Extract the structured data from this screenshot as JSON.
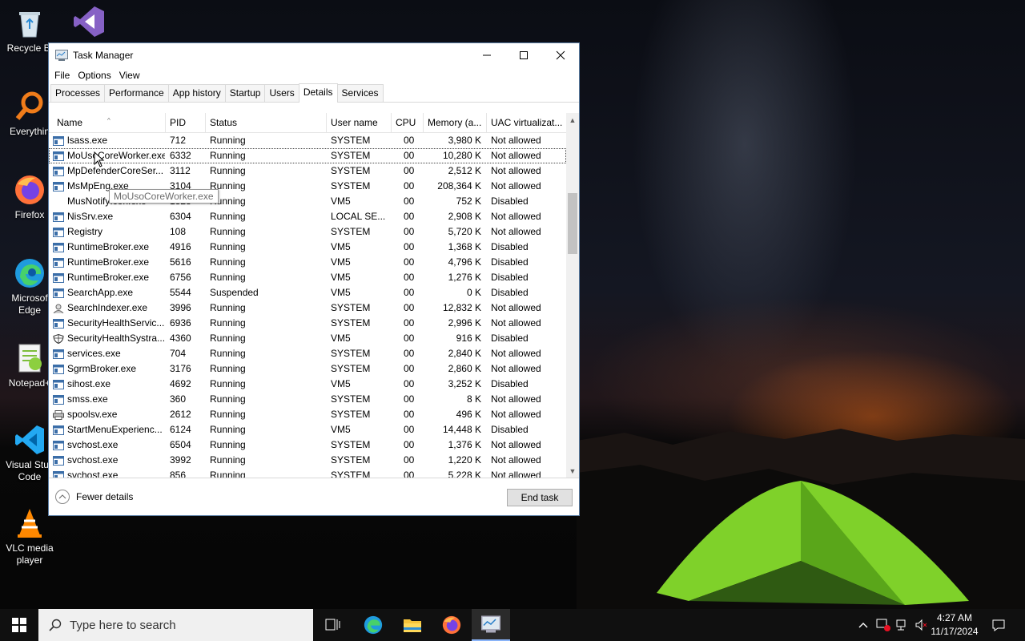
{
  "desktop": {
    "icons": [
      {
        "label": "Recycle Bin",
        "icon": "recycle-bin-icon"
      },
      {
        "label": "Everything",
        "icon": "everything-search-icon"
      },
      {
        "label": "Firefox",
        "icon": "firefox-icon"
      },
      {
        "label": "Microsoft Edge",
        "icon": "edge-icon"
      },
      {
        "label": "Notepad++",
        "icon": "notepad-plus-plus-icon"
      },
      {
        "label": "Visual Studio Code",
        "icon": "vscode-icon"
      },
      {
        "label": "VLC media player",
        "icon": "vlc-icon"
      }
    ],
    "visible_labels": {
      "recycle": "Recycle Bi",
      "everything": "Everythin",
      "firefox": "Firefox",
      "edge_1": "Microsof",
      "edge_2": "Edge",
      "notepad": "Notepad+",
      "vscode_1": "Visual Stuc",
      "vscode_2": "Code",
      "vlc_1": "VLC media",
      "vlc_2": "player"
    }
  },
  "window": {
    "title": "Task Manager",
    "menu": [
      "File",
      "Options",
      "View"
    ],
    "tabs": [
      "Processes",
      "Performance",
      "App history",
      "Startup",
      "Users",
      "Details",
      "Services"
    ],
    "active_tab": "Details",
    "columns": [
      "Name",
      "PID",
      "Status",
      "User name",
      "CPU",
      "Memory (a...",
      "UAC virtualizat..."
    ],
    "rows": [
      {
        "name": "lsass.exe",
        "pid": "712",
        "status": "Running",
        "user": "SYSTEM",
        "cpu": "00",
        "mem": "3,980 K",
        "uac": "Not allowed",
        "icon": "app"
      },
      {
        "name": "MoUsoCoreWorker.exe",
        "pid": "6332",
        "status": "Running",
        "user": "SYSTEM",
        "cpu": "00",
        "mem": "10,280 K",
        "uac": "Not allowed",
        "icon": "app",
        "selected": true
      },
      {
        "name": "MpDefenderCoreSer...",
        "pid": "3112",
        "status": "Running",
        "user": "SYSTEM",
        "cpu": "00",
        "mem": "2,512 K",
        "uac": "Not allowed",
        "icon": "app"
      },
      {
        "name": "MsMpEng.exe",
        "pid": "3104",
        "status": "Running",
        "user": "SYSTEM",
        "cpu": "00",
        "mem": "208,364 K",
        "uac": "Not allowed",
        "icon": "app"
      },
      {
        "name": "MusNotifyIcon.exe",
        "pid": "1828",
        "status": "Running",
        "user": "VM5",
        "cpu": "00",
        "mem": "752 K",
        "uac": "Disabled",
        "icon": "none"
      },
      {
        "name": "NisSrv.exe",
        "pid": "6304",
        "status": "Running",
        "user": "LOCAL SE...",
        "cpu": "00",
        "mem": "2,908 K",
        "uac": "Not allowed",
        "icon": "app"
      },
      {
        "name": "Registry",
        "pid": "108",
        "status": "Running",
        "user": "SYSTEM",
        "cpu": "00",
        "mem": "5,720 K",
        "uac": "Not allowed",
        "icon": "app"
      },
      {
        "name": "RuntimeBroker.exe",
        "pid": "4916",
        "status": "Running",
        "user": "VM5",
        "cpu": "00",
        "mem": "1,368 K",
        "uac": "Disabled",
        "icon": "app"
      },
      {
        "name": "RuntimeBroker.exe",
        "pid": "5616",
        "status": "Running",
        "user": "VM5",
        "cpu": "00",
        "mem": "4,796 K",
        "uac": "Disabled",
        "icon": "app"
      },
      {
        "name": "RuntimeBroker.exe",
        "pid": "6756",
        "status": "Running",
        "user": "VM5",
        "cpu": "00",
        "mem": "1,276 K",
        "uac": "Disabled",
        "icon": "app"
      },
      {
        "name": "SearchApp.exe",
        "pid": "5544",
        "status": "Suspended",
        "user": "VM5",
        "cpu": "00",
        "mem": "0 K",
        "uac": "Disabled",
        "icon": "app"
      },
      {
        "name": "SearchIndexer.exe",
        "pid": "3996",
        "status": "Running",
        "user": "SYSTEM",
        "cpu": "00",
        "mem": "12,832 K",
        "uac": "Not allowed",
        "icon": "user"
      },
      {
        "name": "SecurityHealthServic...",
        "pid": "6936",
        "status": "Running",
        "user": "SYSTEM",
        "cpu": "00",
        "mem": "2,996 K",
        "uac": "Not allowed",
        "icon": "app"
      },
      {
        "name": "SecurityHealthSystra...",
        "pid": "4360",
        "status": "Running",
        "user": "VM5",
        "cpu": "00",
        "mem": "916 K",
        "uac": "Disabled",
        "icon": "shield"
      },
      {
        "name": "services.exe",
        "pid": "704",
        "status": "Running",
        "user": "SYSTEM",
        "cpu": "00",
        "mem": "2,840 K",
        "uac": "Not allowed",
        "icon": "app"
      },
      {
        "name": "SgrmBroker.exe",
        "pid": "3176",
        "status": "Running",
        "user": "SYSTEM",
        "cpu": "00",
        "mem": "2,860 K",
        "uac": "Not allowed",
        "icon": "app"
      },
      {
        "name": "sihost.exe",
        "pid": "4692",
        "status": "Running",
        "user": "VM5",
        "cpu": "00",
        "mem": "3,252 K",
        "uac": "Disabled",
        "icon": "app"
      },
      {
        "name": "smss.exe",
        "pid": "360",
        "status": "Running",
        "user": "SYSTEM",
        "cpu": "00",
        "mem": "8 K",
        "uac": "Not allowed",
        "icon": "app"
      },
      {
        "name": "spoolsv.exe",
        "pid": "2612",
        "status": "Running",
        "user": "SYSTEM",
        "cpu": "00",
        "mem": "496 K",
        "uac": "Not allowed",
        "icon": "printer"
      },
      {
        "name": "StartMenuExperienc...",
        "pid": "6124",
        "status": "Running",
        "user": "VM5",
        "cpu": "00",
        "mem": "14,448 K",
        "uac": "Disabled",
        "icon": "app"
      },
      {
        "name": "svchost.exe",
        "pid": "6504",
        "status": "Running",
        "user": "SYSTEM",
        "cpu": "00",
        "mem": "1,376 K",
        "uac": "Not allowed",
        "icon": "app"
      },
      {
        "name": "svchost.exe",
        "pid": "3992",
        "status": "Running",
        "user": "SYSTEM",
        "cpu": "00",
        "mem": "1,220 K",
        "uac": "Not allowed",
        "icon": "app"
      },
      {
        "name": "svchost.exe",
        "pid": "856",
        "status": "Running",
        "user": "SYSTEM",
        "cpu": "00",
        "mem": "5,228 K",
        "uac": "Not allowed",
        "icon": "app"
      }
    ],
    "tooltip": "MoUsoCoreWorker.exe",
    "fewer_details": "Fewer details",
    "end_task": "End task"
  },
  "taskbar": {
    "search_placeholder": "Type here to search",
    "apps": [
      "task-view-icon",
      "edge-icon",
      "file-explorer-icon",
      "firefox-icon",
      "task-manager-icon"
    ],
    "clock_time": "4:27 AM",
    "clock_date": "11/17/2024"
  },
  "colors": {
    "selection_outline": "#444444",
    "taskbar": "#101010",
    "window_border": "#5b7fa6"
  }
}
